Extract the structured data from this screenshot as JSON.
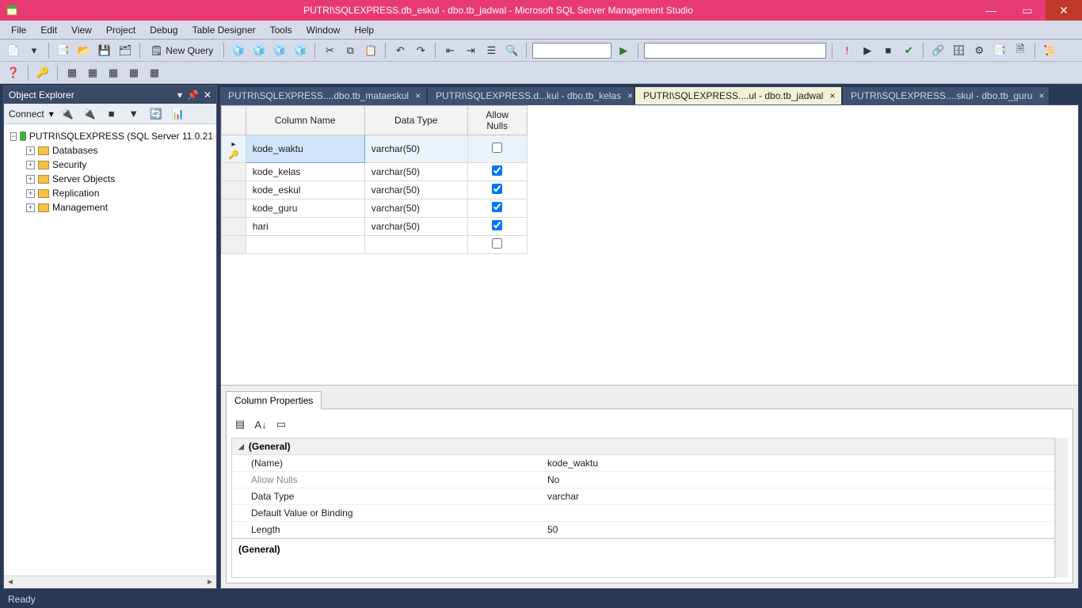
{
  "window": {
    "title": "PUTRI\\SQLEXPRESS.db_eskul - dbo.tb_jadwal - Microsoft SQL Server Management Studio"
  },
  "menu": [
    "File",
    "Edit",
    "View",
    "Project",
    "Debug",
    "Table Designer",
    "Tools",
    "Window",
    "Help"
  ],
  "toolbar1": {
    "newquery": "New Query"
  },
  "objectExplorer": {
    "title": "Object Explorer",
    "connect_label": "Connect",
    "root": "PUTRI\\SQLEXPRESS (SQL Server 11.0.21",
    "nodes": [
      "Databases",
      "Security",
      "Server Objects",
      "Replication",
      "Management"
    ]
  },
  "tabs": [
    {
      "label": "PUTRI\\SQLEXPRESS....dbo.tb_mataeskul",
      "active": false
    },
    {
      "label": "PUTRI\\SQLEXPRESS.d...kul - dbo.tb_kelas",
      "active": false
    },
    {
      "label": "PUTRI\\SQLEXPRESS....ul - dbo.tb_jadwal",
      "active": true
    },
    {
      "label": "PUTRI\\SQLEXPRESS....skul - dbo.tb_guru",
      "active": false
    }
  ],
  "grid": {
    "headers": {
      "col": "Column Name",
      "type": "Data Type",
      "nulls": "Allow Nulls"
    },
    "rows": [
      {
        "pk": true,
        "selected": true,
        "name": "kode_waktu",
        "type": "varchar(50)",
        "nulls": false
      },
      {
        "pk": false,
        "selected": false,
        "name": "kode_kelas",
        "type": "varchar(50)",
        "nulls": true
      },
      {
        "pk": false,
        "selected": false,
        "name": "kode_eskul",
        "type": "varchar(50)",
        "nulls": true
      },
      {
        "pk": false,
        "selected": false,
        "name": "kode_guru",
        "type": "varchar(50)",
        "nulls": true
      },
      {
        "pk": false,
        "selected": false,
        "name": "hari",
        "type": "varchar(50)",
        "nulls": true
      }
    ]
  },
  "properties": {
    "tab": "Column Properties",
    "group": "(General)",
    "rows": [
      {
        "k": "(Name)",
        "v": "kode_waktu",
        "dim": false
      },
      {
        "k": "Allow Nulls",
        "v": "No",
        "dim": true
      },
      {
        "k": "Data Type",
        "v": "varchar",
        "dim": false
      },
      {
        "k": "Default Value or Binding",
        "v": "",
        "dim": false
      },
      {
        "k": "Length",
        "v": "50",
        "dim": false
      }
    ],
    "desc_head": "(General)"
  },
  "status": "Ready"
}
